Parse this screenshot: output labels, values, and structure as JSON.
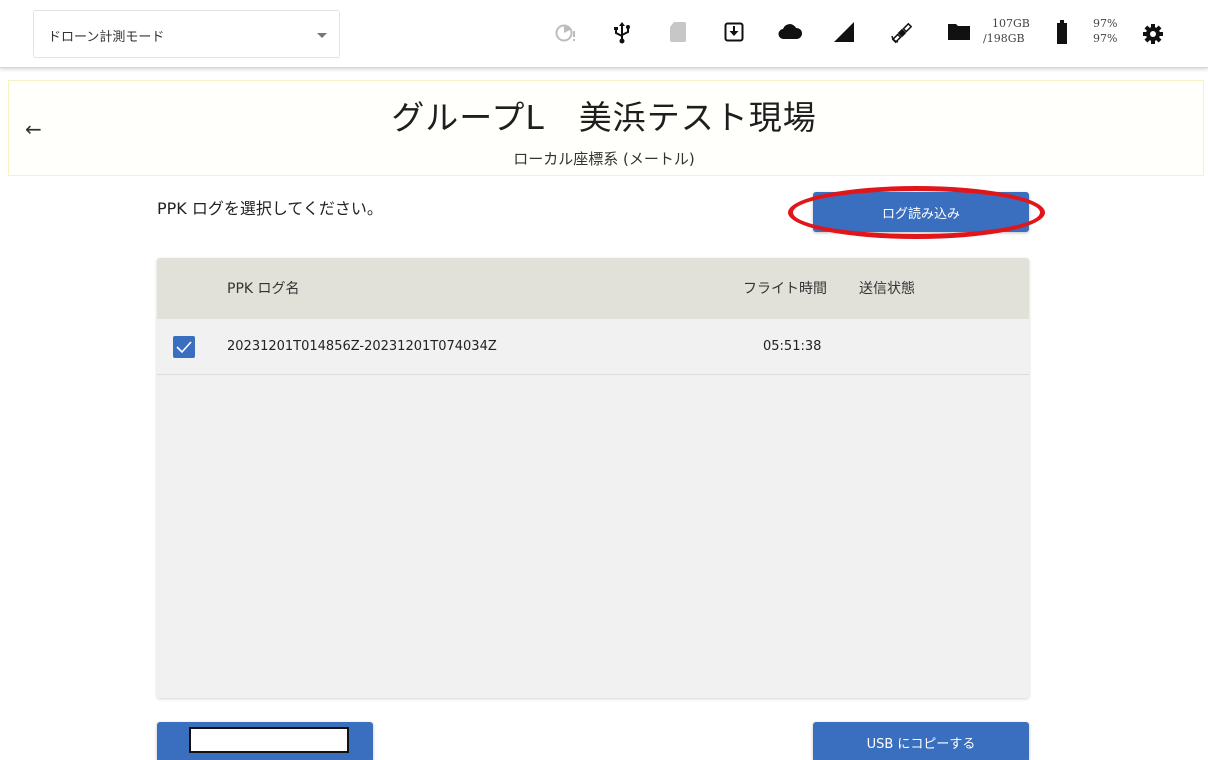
{
  "topbar": {
    "mode_label": "ドローン計測モード",
    "storage_used": "107GB",
    "storage_total": "/198GB",
    "battery_1": "97%",
    "battery_2": "97%",
    "icons": [
      "timer-alert-icon",
      "usb-icon",
      "sd-card-icon",
      "download-box-icon",
      "cloud-icon",
      "signal-icon",
      "satellite-icon",
      "folder-icon",
      "battery-icon",
      "gear-icon"
    ]
  },
  "header": {
    "title": "グループL　美浜テスト現場",
    "subtitle": "ローカル座標系 (メートル)"
  },
  "main": {
    "instruction": "PPK ログを選択してください。",
    "load_button": "ログ読み込み",
    "table": {
      "columns": [
        "PPK ログ名",
        "フライト時間",
        "送信状態"
      ],
      "rows": [
        {
          "checked": true,
          "name": "20231201T014856Z-20231201T074034Z",
          "flight_time": "05:51:38",
          "status": ""
        }
      ]
    },
    "usb_button": "USB にコピーする"
  },
  "colors": {
    "primary": "#3a6fc0",
    "highlight": "#e0161b",
    "table_header": "#e1e1da",
    "table_body": "#f1f1f1"
  }
}
